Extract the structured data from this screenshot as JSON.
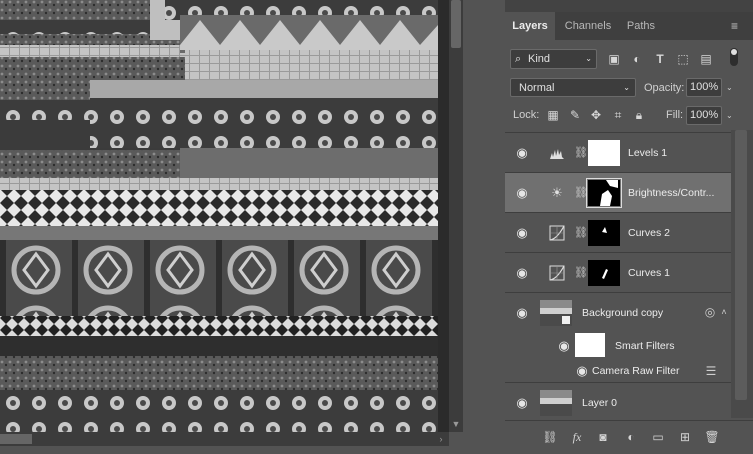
{
  "panel": {
    "tabs": [
      {
        "label": "Layers",
        "active": true
      },
      {
        "label": "Channels",
        "active": false
      },
      {
        "label": "Paths",
        "active": false
      }
    ],
    "filter": {
      "label": "Kind"
    },
    "blend_mode": "Normal",
    "opacity_label": "Opacity:",
    "opacity_value": "100%",
    "lock_label": "Lock:",
    "fill_label": "Fill:",
    "fill_value": "100%"
  },
  "layers": [
    {
      "name": "Levels 1",
      "type": "levels",
      "visible": true,
      "selected": false
    },
    {
      "name": "Brightness/Contr...",
      "type": "brightness",
      "visible": true,
      "selected": true
    },
    {
      "name": "Curves 2",
      "type": "curves",
      "visible": true,
      "selected": false
    },
    {
      "name": "Curves 1",
      "type": "curves",
      "visible": true,
      "selected": false
    },
    {
      "name": "Background copy",
      "type": "smart-object",
      "visible": true,
      "selected": false
    },
    {
      "name": "Smart Filters",
      "type": "smart-filters",
      "visible": true,
      "selected": false
    },
    {
      "name": "Camera Raw Filter",
      "type": "filter",
      "visible": true,
      "selected": false
    },
    {
      "name": "Layer 0",
      "type": "pixel",
      "visible": true,
      "selected": false
    }
  ],
  "icons": {
    "eye": "eye-icon",
    "chain": "link-icon",
    "levels": "levels-icon",
    "brightness": "brightness-contrast-icon",
    "curves": "curves-icon"
  },
  "colors": {
    "panel_bg": "#535353",
    "selected_row": "#707070",
    "tab_bar": "#3f3f3f"
  }
}
